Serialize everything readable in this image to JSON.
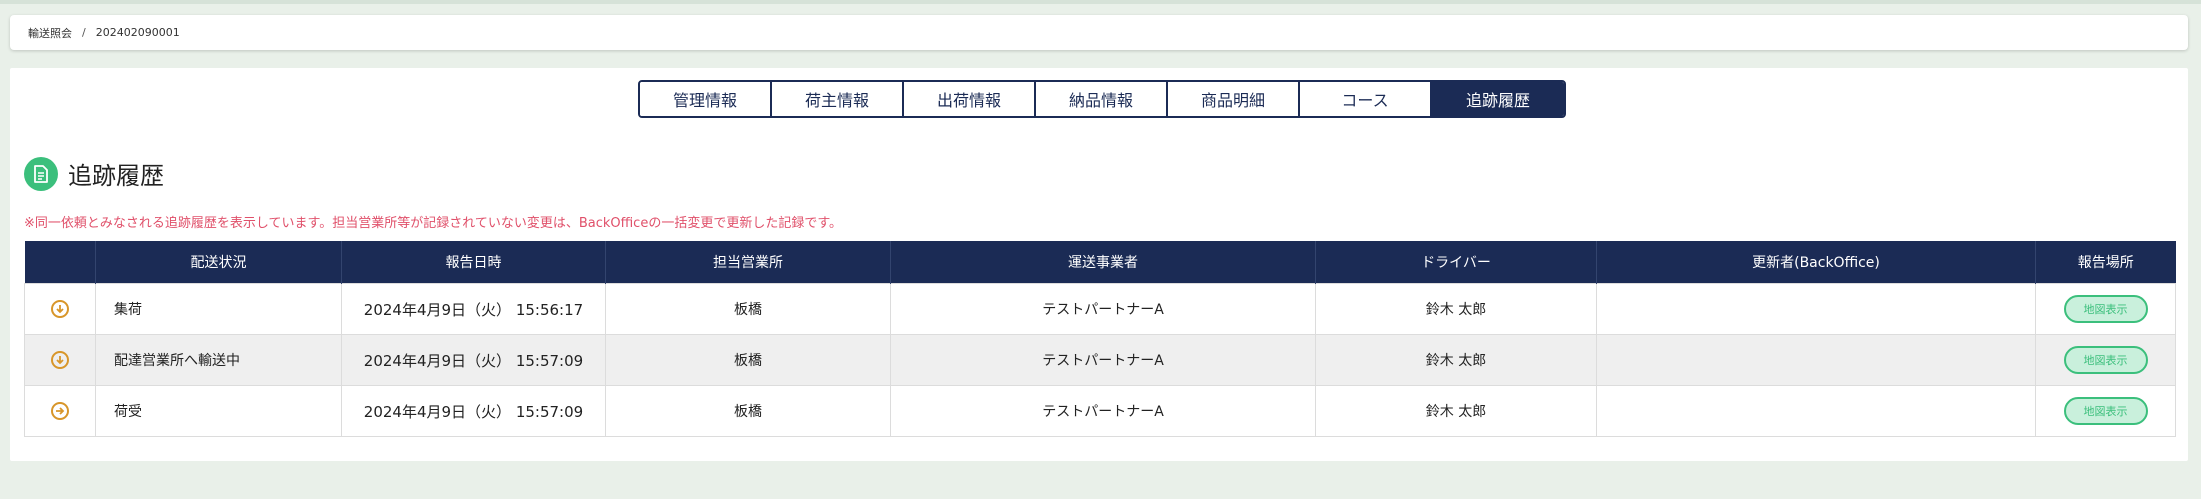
{
  "breadcrumb": {
    "parent": "輸送照会",
    "separator": "/",
    "current": "202402090001"
  },
  "tabs": [
    {
      "label": "管理情報",
      "active": false
    },
    {
      "label": "荷主情報",
      "active": false
    },
    {
      "label": "出荷情報",
      "active": false
    },
    {
      "label": "納品情報",
      "active": false
    },
    {
      "label": "商品明細",
      "active": false
    },
    {
      "label": "コース",
      "active": false
    },
    {
      "label": "追跡履歴",
      "active": true
    }
  ],
  "section": {
    "title": "追跡履歴",
    "icon": "document-icon",
    "notice": "※同一依頼とみなされる追跡履歴を表示しています。担当営業所等が記録されていない変更は、BackOfficeの一括変更で更新した記録です。"
  },
  "table": {
    "headers": [
      "",
      "配送状況",
      "報告日時",
      "担当営業所",
      "運送事業者",
      "ドライバー",
      "更新者(BackOffice)",
      "報告場所"
    ],
    "rows": [
      {
        "icon": "arrow-down-circle-icon",
        "status": "集荷",
        "datetime": "2024年4月9日（火） 15:56:17",
        "office": "板橋",
        "carrier": "テストパートナーA",
        "driver": "鈴木 太郎",
        "updater": "",
        "location_button": "地図表示"
      },
      {
        "icon": "arrow-down-circle-icon",
        "status": "配達営業所へ輸送中",
        "datetime": "2024年4月9日（火） 15:57:09",
        "office": "板橋",
        "carrier": "テストパートナーA",
        "driver": "鈴木 太郎",
        "updater": "",
        "location_button": "地図表示"
      },
      {
        "icon": "arrow-right-circle-icon",
        "status": "荷受",
        "datetime": "2024年4月9日（火） 15:57:09",
        "office": "板橋",
        "carrier": "テストパートナーA",
        "driver": "鈴木 太郎",
        "updater": "",
        "location_button": "地図表示"
      }
    ]
  },
  "colors": {
    "navy": "#1b2b55",
    "accent_green": "#3bbf7c",
    "notice_red": "#e0506a",
    "status_orange": "#d8962a"
  }
}
